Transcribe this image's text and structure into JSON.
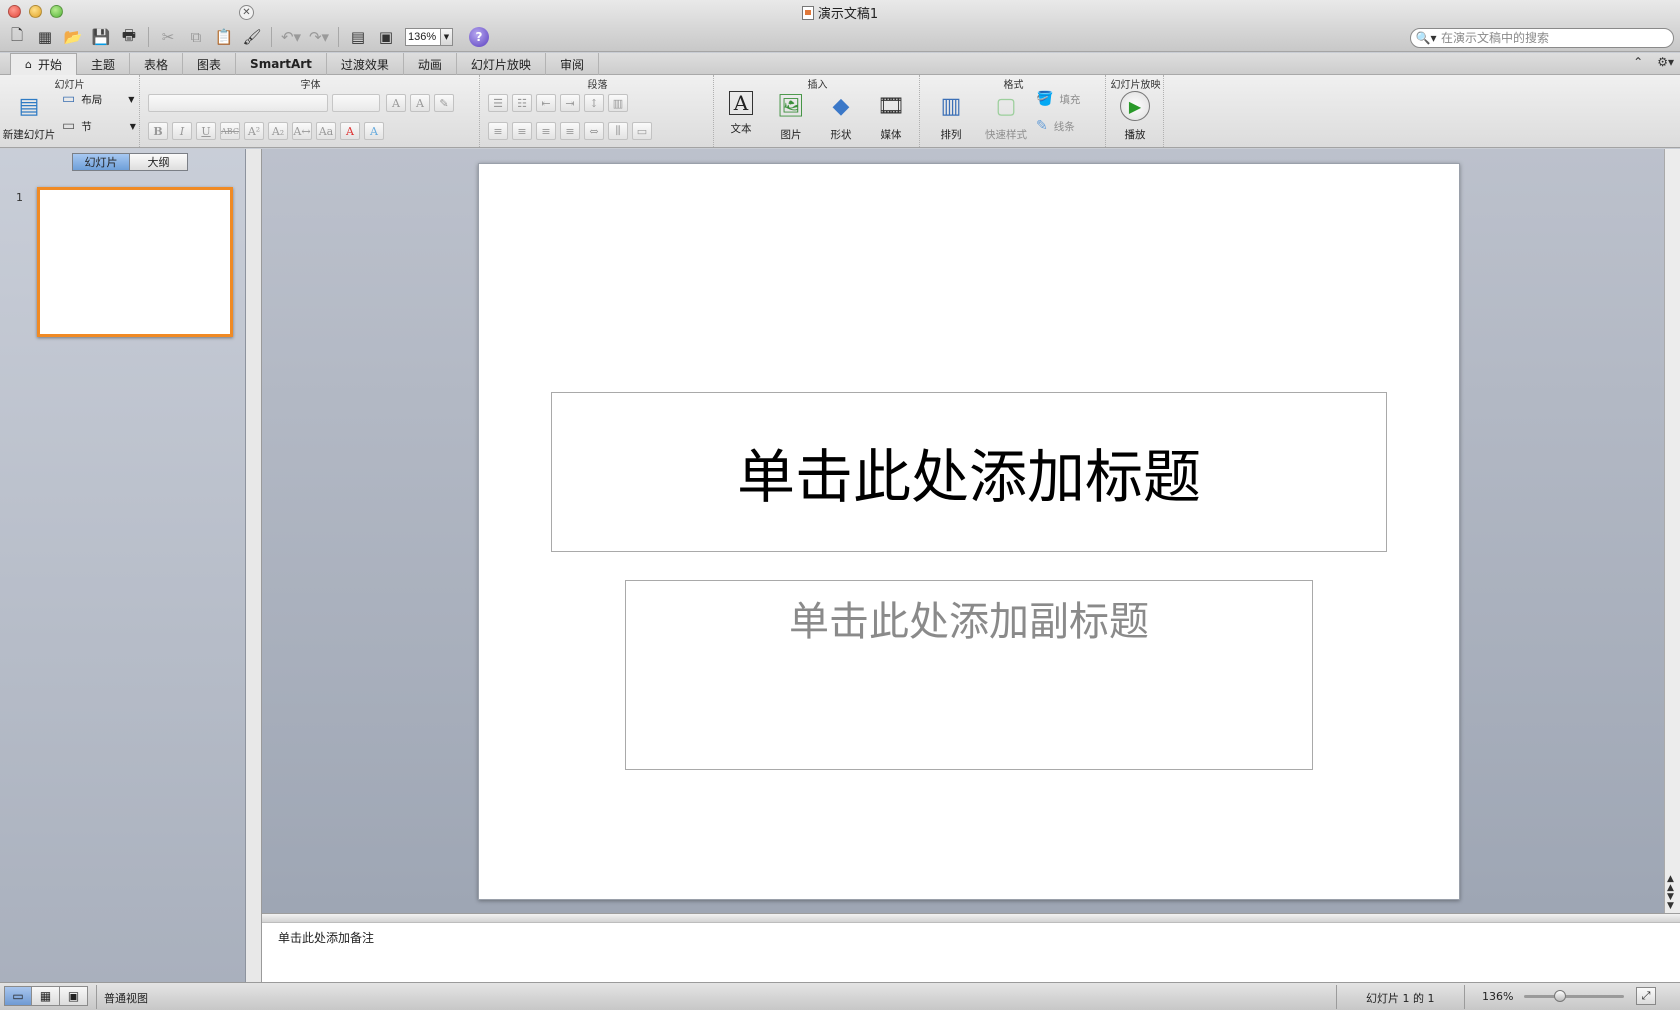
{
  "window": {
    "title": "演示文稿1"
  },
  "toolbar": {
    "zoom": "136%",
    "help": "?"
  },
  "search": {
    "placeholder": "在演示文稿中的搜索"
  },
  "tabs": [
    "开始",
    "主题",
    "表格",
    "图表",
    "SmartArt",
    "过渡效果",
    "动画",
    "幻灯片放映",
    "审阅"
  ],
  "ribbon": {
    "groups": {
      "slides": "幻灯片",
      "font": "字体",
      "paragraph": "段落",
      "insert": "插入",
      "format": "格式",
      "slideshow": "幻灯片放映"
    },
    "new_slide": "新建幻灯片",
    "layout": "布局",
    "section": "节",
    "text": "文本",
    "picture": "图片",
    "shape": "形状",
    "media": "媒体",
    "arrange": "排列",
    "quick_styles": "快速样式",
    "fill": "填充",
    "line": "线条",
    "play": "播放"
  },
  "panel": {
    "tab_slides": "幻灯片",
    "tab_outline": "大纲",
    "slide_number": "1"
  },
  "slide": {
    "title_placeholder": "单击此处添加标题",
    "subtitle_placeholder": "单击此处添加副标题"
  },
  "notes": {
    "placeholder": "单击此处添加备注"
  },
  "status": {
    "view": "普通视图",
    "slide_count": "幻灯片 1 的 1",
    "zoom": "136%"
  }
}
